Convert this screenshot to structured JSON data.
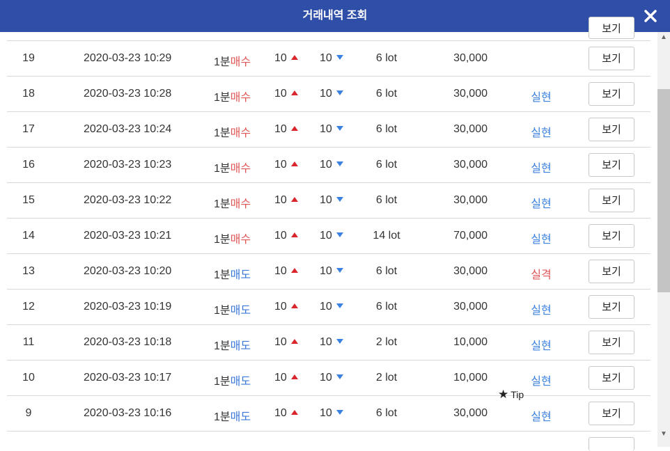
{
  "header": {
    "title": "거래내역 조회"
  },
  "button_label": "보기",
  "tip_label": "Tip",
  "rows": [
    {
      "num": "19",
      "datetime": "2020-03-23 10:29",
      "period": "1분",
      "direction": "매수",
      "direction_type": "buy",
      "up": "10",
      "down": "10",
      "lot": "6 lot",
      "amount": "30,000",
      "result": "",
      "result_type": ""
    },
    {
      "num": "18",
      "datetime": "2020-03-23 10:28",
      "period": "1분",
      "direction": "매수",
      "direction_type": "buy",
      "up": "10",
      "down": "10",
      "lot": "6 lot",
      "amount": "30,000",
      "result": "실현",
      "result_type": "ok"
    },
    {
      "num": "17",
      "datetime": "2020-03-23 10:24",
      "period": "1분",
      "direction": "매수",
      "direction_type": "buy",
      "up": "10",
      "down": "10",
      "lot": "6 lot",
      "amount": "30,000",
      "result": "실현",
      "result_type": "ok"
    },
    {
      "num": "16",
      "datetime": "2020-03-23 10:23",
      "period": "1분",
      "direction": "매수",
      "direction_type": "buy",
      "up": "10",
      "down": "10",
      "lot": "6 lot",
      "amount": "30,000",
      "result": "실현",
      "result_type": "ok"
    },
    {
      "num": "15",
      "datetime": "2020-03-23 10:22",
      "period": "1분",
      "direction": "매수",
      "direction_type": "buy",
      "up": "10",
      "down": "10",
      "lot": "6 lot",
      "amount": "30,000",
      "result": "실현",
      "result_type": "ok"
    },
    {
      "num": "14",
      "datetime": "2020-03-23 10:21",
      "period": "1분",
      "direction": "매수",
      "direction_type": "buy",
      "up": "10",
      "down": "10",
      "lot": "14 lot",
      "amount": "70,000",
      "result": "실현",
      "result_type": "ok"
    },
    {
      "num": "13",
      "datetime": "2020-03-23 10:20",
      "period": "1분",
      "direction": "매도",
      "direction_type": "sell",
      "up": "10",
      "down": "10",
      "lot": "6 lot",
      "amount": "30,000",
      "result": "실격",
      "result_type": "fail"
    },
    {
      "num": "12",
      "datetime": "2020-03-23 10:19",
      "period": "1분",
      "direction": "매도",
      "direction_type": "sell",
      "up": "10",
      "down": "10",
      "lot": "6 lot",
      "amount": "30,000",
      "result": "실현",
      "result_type": "ok"
    },
    {
      "num": "11",
      "datetime": "2020-03-23 10:18",
      "period": "1분",
      "direction": "매도",
      "direction_type": "sell",
      "up": "10",
      "down": "10",
      "lot": "2 lot",
      "amount": "10,000",
      "result": "실현",
      "result_type": "ok"
    },
    {
      "num": "10",
      "datetime": "2020-03-23 10:17",
      "period": "1분",
      "direction": "매도",
      "direction_type": "sell",
      "up": "10",
      "down": "10",
      "lot": "2 lot",
      "amount": "10,000",
      "result": "실현",
      "result_type": "ok"
    },
    {
      "num": "9",
      "datetime": "2020-03-23 10:16",
      "period": "1분",
      "direction": "매도",
      "direction_type": "sell",
      "up": "10",
      "down": "10",
      "lot": "6 lot",
      "amount": "30,000",
      "result": "실현",
      "result_type": "ok"
    }
  ],
  "colors": {
    "header_bg": "#2f4ea8",
    "buy": "#e05555",
    "sell": "#3b78d8",
    "result_ok": "#3b82e0",
    "result_fail": "#e05555",
    "arrow_up": "#d9262c",
    "arrow_down": "#3b82e0"
  },
  "icons": {
    "close": "close-icon",
    "up": "triangle-up-icon",
    "down": "triangle-down-icon",
    "tip": "star-icon"
  }
}
